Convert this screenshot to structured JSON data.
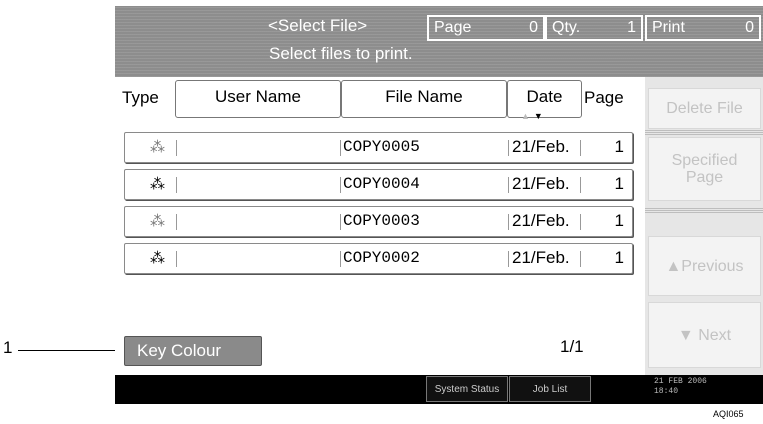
{
  "callout": {
    "number": "1"
  },
  "header": {
    "title": "<Select File>",
    "subtitle": "Select files to print.",
    "page_label": "Page",
    "page_value": "0",
    "qty_label": "Qty.",
    "qty_value": "1",
    "print_label": "Print",
    "print_value": "0"
  },
  "columns": {
    "type": "Type",
    "user_name": "User Name",
    "file_name": "File Name",
    "date": "Date",
    "page": "Page"
  },
  "files": [
    {
      "icon": "colour-icon",
      "user": "",
      "file": "COPY0005",
      "date": "21/Feb.",
      "pages": "1"
    },
    {
      "icon": "black-white-icon",
      "user": "",
      "file": "COPY0004",
      "date": "21/Feb.",
      "pages": "1"
    },
    {
      "icon": "colour-icon",
      "user": "",
      "file": "COPY0003",
      "date": "21/Feb.",
      "pages": "1"
    },
    {
      "icon": "black-white-icon",
      "user": "",
      "file": "COPY0002",
      "date": "21/Feb.",
      "pages": "1"
    }
  ],
  "pagination": "1/1",
  "key_colour_label": "Key Colour",
  "right_panel": {
    "delete_file": "Delete File",
    "specified_line1": "Specified",
    "specified_line2": "Page",
    "previous": "▲Previous",
    "next": "▼ Next"
  },
  "status_bar": {
    "system_status": "System Status",
    "job_list": "Job List",
    "date": "21 FEB  2006",
    "time": "18:40"
  },
  "figure_id": "AQI065"
}
